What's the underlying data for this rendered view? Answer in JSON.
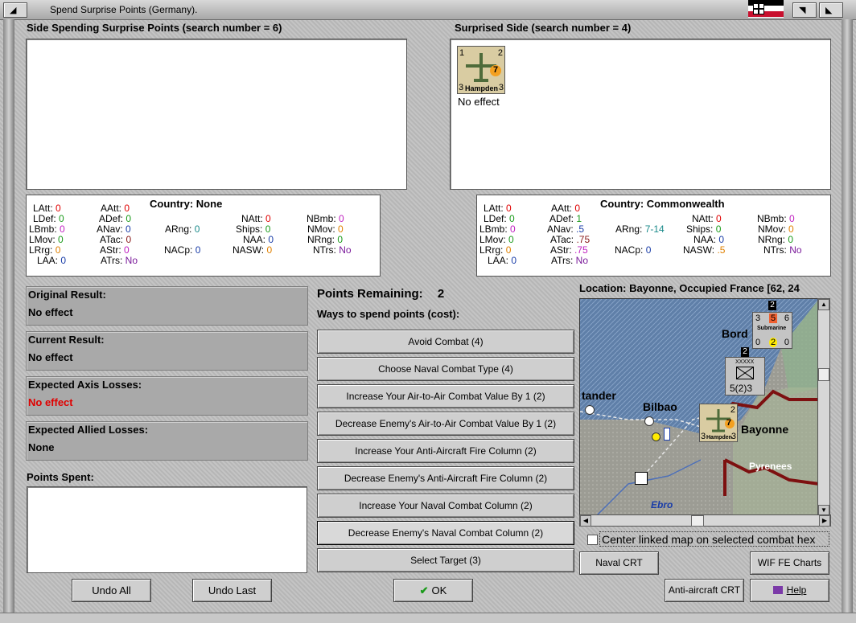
{
  "window": {
    "title": "Spend Surprise Points (Germany)."
  },
  "colors": {
    "red_text": "#e00000",
    "panel_gray": "#a9a9a9",
    "map_sea": "#5f7fa8",
    "map_land": "#9c9c94",
    "border_red": "#8a1515"
  },
  "spending": {
    "heading": "Side Spending Surprise Points (search number = 6)",
    "stats": {
      "country_label": "Country:",
      "country": "None",
      "LAtt": "0",
      "LDef": "0",
      "LBmb": "0",
      "LMov": "0",
      "LRrg": "0",
      "LAA": "0",
      "AAtt": "0",
      "ADef": "0",
      "ANav": "0",
      "ATac": "0",
      "AStr": "0",
      "ATrs": "No",
      "ARng": "0",
      "NACp": "0",
      "NAtt": "0",
      "Ships": "0",
      "NAA": "0",
      "NASW": "0",
      "NBmb": "0",
      "NMov": "0",
      "NRng": "0",
      "NTrs": "No"
    }
  },
  "surprised": {
    "heading": "Surprised Side (search number = 4)",
    "unit": {
      "name": "Hampden",
      "attack": "7",
      "top_right": "2",
      "left": "3",
      "right": "3",
      "top_left": "1",
      "result": "No effect"
    },
    "stats": {
      "country_label": "Country:",
      "country": "Commonwealth",
      "LAtt": "0",
      "LDef": "0",
      "LBmb": "0",
      "LMov": "0",
      "LRrg": "0",
      "LAA": "0",
      "AAtt": "0",
      "ADef": "1",
      "ANav": ".5",
      "ATac": ".75",
      "AStr": ".75",
      "ATrs": "No",
      "ARng": "7-14",
      "NACp": "0",
      "NAtt": "0",
      "Ships": "0",
      "NAA": "0",
      "NASW": ".5",
      "NBmb": "0",
      "NMov": "0",
      "NRng": "0",
      "NTrs": "No"
    }
  },
  "results": {
    "original_label": "Original Result:",
    "original_value": "No effect",
    "current_label": "Current Result:",
    "current_value": "No effect",
    "axis_label": "Expected Axis Losses:",
    "axis_value": "No effect",
    "allied_label": "Expected Allied Losses:",
    "allied_value": "None",
    "points_spent_label": "Points Spent:"
  },
  "points": {
    "remaining_label": "Points Remaining:",
    "remaining_value": "2",
    "ways_label": "Ways to spend points (cost):"
  },
  "options": [
    "Avoid Combat (4)",
    "Choose Naval Combat Type (4)",
    "Increase Your Air-to-Air Combat Value By 1 (2)",
    "Decrease Enemy's Air-to-Air Combat Value By 1 (2)",
    "Increase Your Anti-Aircraft Fire Column (2)",
    "Decrease Enemy's Anti-Aircraft Fire Column (2)",
    "Increase Your Naval Combat Column (2)",
    "Decrease Enemy's Naval Combat Column (2)",
    "Select Target (3)"
  ],
  "map": {
    "location": "Location: Bayonne, Occupied France [62, 24",
    "labels": {
      "bordeaux": "Bord",
      "santander": "tander",
      "bilbao": "Bilbao",
      "bayonne": "Bayonne",
      "pyrenees": "Pyrenees",
      "ebro": "Ebro"
    },
    "sub": {
      "label": "Submarine",
      "top": "2",
      "a": "3",
      "b": "5",
      "c": "6",
      "d": "0",
      "e": "2",
      "f": "0"
    },
    "hq": {
      "value": "5(2)3",
      "top": "2",
      "symbol": "XXXXX"
    },
    "air": {
      "attack": "7",
      "name": "Hampden",
      "left": "3",
      "right": "3",
      "top": "2"
    }
  },
  "center_linked": "Center linked map on selected combat hex",
  "buttons": {
    "undo_all": "Undo All",
    "undo_last": "Undo Last",
    "ok": "OK",
    "naval_crt": "Naval CRT",
    "wif_fe": "WIF FE Charts",
    "aa_crt": "Anti-aircraft CRT",
    "help": "Help"
  }
}
